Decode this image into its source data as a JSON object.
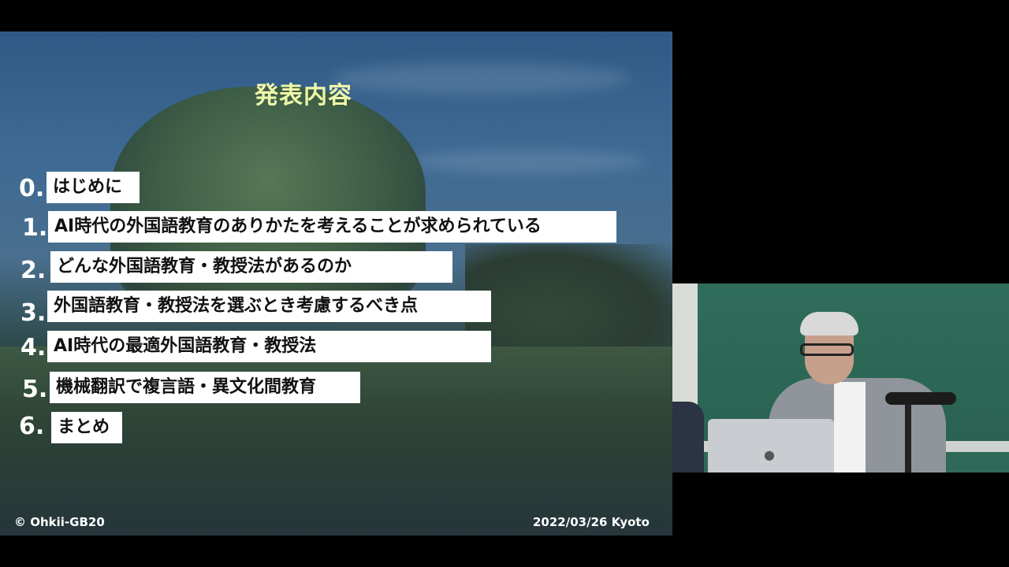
{
  "slide": {
    "title": "発表内容",
    "items": [
      {
        "num": "0.",
        "text": "はじめに"
      },
      {
        "num": "1.",
        "text": "AI時代の外国語教育のありかたを考えることが求められている"
      },
      {
        "num": "2.",
        "text": "どんな外国語教育・教授法があるのか"
      },
      {
        "num": "3.",
        "text": "外国語教育・教授法を選ぶとき考慮するべき点"
      },
      {
        "num": "4.",
        "text": "AI時代の最適外国語教育・教授法"
      },
      {
        "num": "5.",
        "text": "機械翻訳で複言語・異文化間教育"
      },
      {
        "num": "6.",
        "text": "まとめ"
      }
    ],
    "footer_left": "© Ohkii-GB20",
    "footer_right": "2022/03/26 Kyoto"
  },
  "camera": {
    "laptop_logo_icon": "apple-logo-icon"
  }
}
